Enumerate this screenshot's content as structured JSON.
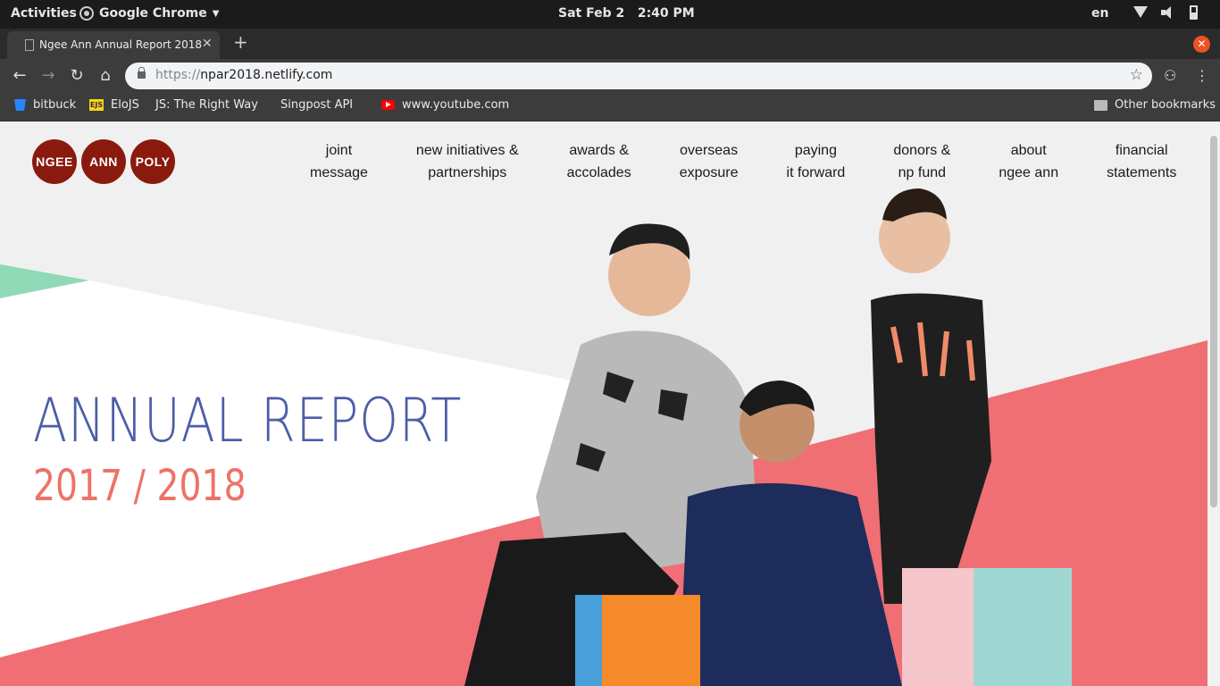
{
  "system_bar": {
    "activities": "Activities",
    "app_name": "Google Chrome",
    "clock": "Sat Feb 2   2:40 PM",
    "language": "en"
  },
  "browser": {
    "tab_title": "Ngee Ann Annual Report 2018",
    "url_scheme": "https://",
    "url_host": "npar2018.netlify.com",
    "bookmarks": [
      {
        "label": "bitbuck",
        "icon": "bitbucket-icon"
      },
      {
        "label": "EloJS",
        "icon": "ejs-icon"
      },
      {
        "label": "JS: The Right Way",
        "icon": "page-icon"
      },
      {
        "label": "Singpost API",
        "icon": "page-icon"
      },
      {
        "label": "www.youtube.com",
        "icon": "youtube-icon"
      }
    ],
    "other_bookmarks": "Other bookmarks",
    "colors": {
      "chrome_dark": "#3c3c3c",
      "close_orange": "#e95420"
    }
  },
  "site": {
    "logo": [
      "NGEE",
      "ANN",
      "POLY"
    ],
    "nav": [
      {
        "line1": "joint",
        "line2": "message"
      },
      {
        "line1": "new initiatives &",
        "line2": "partnerships"
      },
      {
        "line1": "awards &",
        "line2": "accolades"
      },
      {
        "line1": "overseas",
        "line2": "exposure"
      },
      {
        "line1": "paying",
        "line2": "it forward"
      },
      {
        "line1": "donors &",
        "line2": "np fund"
      },
      {
        "line1": "about",
        "line2": "ngee ann"
      },
      {
        "line1": "financial",
        "line2": "statements"
      }
    ],
    "hero_title": "ANNUAL REPORT",
    "hero_years": "2017 / 2018",
    "colors": {
      "logo_red": "#8b1a0e",
      "title_blue": "#4c5ea8",
      "years_coral": "#ee7268",
      "band_coral": "#ef6f74",
      "mint": "#8fd9b6"
    }
  }
}
